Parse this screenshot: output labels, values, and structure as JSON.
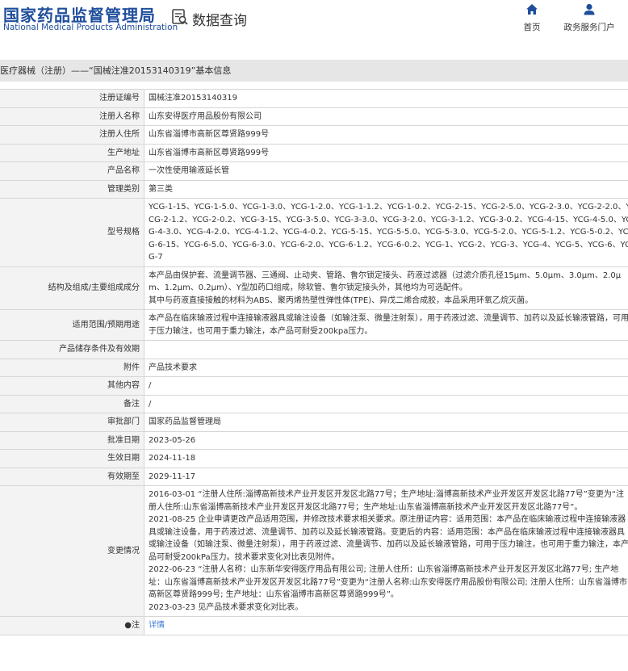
{
  "header": {
    "logo_cn": "国家药品监督管理局",
    "logo_en": "National Medical Products Administration",
    "db_title": "数据查询",
    "nav_home": "首页",
    "nav_portal": "政务服务门户"
  },
  "breadcrumb": "医疗器械（注册）——“国械注准20153140319”基本信息",
  "rows": [
    {
      "label": "注册证编号",
      "value": "国械注准20153140319"
    },
    {
      "label": "注册人名称",
      "value": "山东安得医疗用品股份有限公司"
    },
    {
      "label": "注册人住所",
      "value": "山东省淄博市高新区尊贤路999号"
    },
    {
      "label": "生产地址",
      "value": "山东省淄博市高新区尊贤路999号"
    },
    {
      "label": "产品名称",
      "value": "一次性使用输液延长管"
    },
    {
      "label": "管理类别",
      "value": "第三类"
    },
    {
      "label": "型号规格",
      "value": "YCG-1-15、YCG-1-5.0、YCG-1-3.0、YCG-1-2.0、YCG-1-1.2、YCG-1-0.2、YCG-2-15、YCG-2-5.0、YCG-2-3.0、YCG-2-2.0、YCG-2-1.2、YCG-2-0.2、YCG-3-15、YCG-3-5.0、YCG-3-3.0、YCG-3-2.0、YCG-3-1.2、YCG-3-0.2、YCG-4-15、YCG-4-5.0、YCG-4-3.0、YCG-4-2.0、YCG-4-1.2、YCG-4-0.2、YCG-5-15、YCG-5-5.0、YCG-5-3.0、YCG-5-2.0、YCG-5-1.2、YCG-5-0.2、YCG-6-15、YCG-6-5.0、YCG-6-3.0、YCG-6-2.0、YCG-6-1.2、YCG-6-0.2、YCG-1、YCG-2、YCG-3、YCG-4、YCG-5、YCG-6、YCG-7"
    },
    {
      "label": "结构及组成/主要组成成分",
      "value": "本产品由保护套、流量调节器、三通阀、止动夹、管路、鲁尔锁定接头、药液过滤器（过滤介质孔径15μm、5.0μm、3.0μm、2.0μm、1.2μm、0.2μm）、Y型加药口组成，除软管、鲁尔锁定接头外，其他均为可选配件。\n其中与药液直接接触的材料为ABS、聚丙烯热塑性弹性体(TPE)、异戊二烯合成胶，本品采用环氧乙烷灭菌。"
    },
    {
      "label": "适用范围/预期用途",
      "value": "本产品在临床输液过程中连接输液器具或输注设备（如输注泵、微量注射泵），用于药液过滤、流量调节、加药以及延长输液管路，可用于压力输注，也可用于重力输注，本产品可耐受200kpa压力。"
    },
    {
      "label": "产品储存条件及有效期",
      "value": ""
    },
    {
      "label": "附件",
      "value": "产品技术要求"
    },
    {
      "label": "其他内容",
      "value": "/"
    },
    {
      "label": "备注",
      "value": "/"
    },
    {
      "label": "审批部门",
      "value": "国家药品监督管理局"
    },
    {
      "label": "批准日期",
      "value": "2023-05-26"
    },
    {
      "label": "生效日期",
      "value": "2024-11-18"
    },
    {
      "label": "有效期至",
      "value": "2029-11-17"
    },
    {
      "label": "变更情况",
      "value": "2016-03-01 “注册人住所:淄博高新技术产业开发区开发区北路77号；生产地址:淄博高新技术产业开发区开发区北路77号”变更为“注册人住所:山东省淄博高新技术产业开发区开发区北路77号；生产地址:山东省淄博高新技术产业开发区开发区北路77号”。\n2021-08-25 企业申请更改产品适用范围，并修改技术要求相关要求。原注册证内容：适用范围：本产品在临床输液过程中连接输液器具或输注设备，用于药液过滤、流量调节、加药以及延长输液管路。变更后的内容：适用范围：本产品在临床输液过程中连接输液器具或输注设备（如输注泵、微量注射泵），用于药液过滤、流量调节、加药以及延长输液管路，可用于压力输注，也可用于重力输注，本产品可耐受200kPa压力。技术要求变化对比表见附件。\n2022-06-23 “注册人名称：山东新华安得医疗用品有限公司; 注册人住所：山东省淄博高新技术产业开发区开发区北路77号; 生产地址：山东省淄博高新技术产业开发区开发区北路77号”变更为“注册人名称:山东安得医疗用品股份有限公司; 注册人住所：山东省淄博市高新区尊贤路999号; 生产地址：山东省淄博市高新区尊贤路999号”。\n2023-03-23 见产品技术要求变化对比表。"
    },
    {
      "label": "注",
      "value": "详情"
    }
  ]
}
